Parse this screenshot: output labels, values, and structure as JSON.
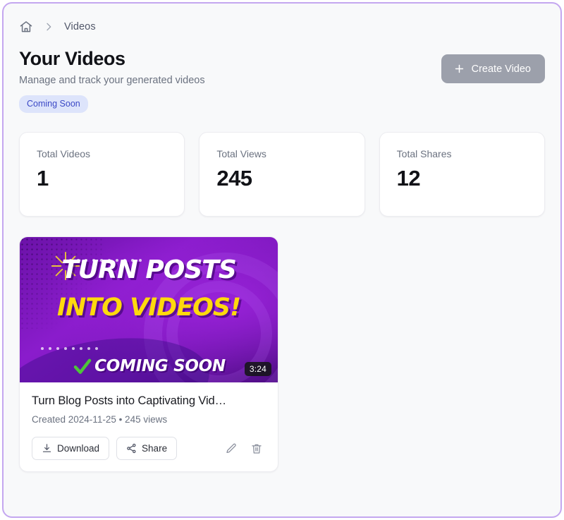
{
  "breadcrumb": {
    "home_icon": "home-icon",
    "separator_icon": "chevron-right-icon",
    "current": "Videos"
  },
  "header": {
    "title": "Your Videos",
    "subtitle": "Manage and track your generated videos",
    "status_badge": "Coming Soon",
    "create_button": {
      "label": "Create Video",
      "icon": "plus-icon",
      "disabled": true,
      "color": "#9ca0ab"
    }
  },
  "stats": [
    {
      "label": "Total Videos",
      "value": "1"
    },
    {
      "label": "Total Views",
      "value": "245"
    },
    {
      "label": "Total Shares",
      "value": "12"
    }
  ],
  "videos": [
    {
      "thumbnail": {
        "line1": "TURN POSTS",
        "line2": "INTO VIDEOS!",
        "overlay_text": "COMING SOON",
        "check_icon": "check-mark-icon",
        "colors": {
          "background_purple": "#8a1ccc",
          "headline_white": "#ffffff",
          "headline_yellow": "#ffd90d",
          "check_green": "#4ec43a"
        }
      },
      "duration": "3:24",
      "title": "Turn Blog Posts into Captivating Vid…",
      "meta": "Created 2024-11-25  •  245 views",
      "actions": {
        "download": {
          "label": "Download",
          "icon": "download-icon"
        },
        "share": {
          "label": "Share",
          "icon": "share-nodes-icon"
        },
        "edit_icon": "pencil-icon",
        "delete_icon": "trash-icon"
      }
    }
  ],
  "theme": {
    "frame_border": "#c4a7f0",
    "page_background": "#f8f9fa",
    "badge_background": "#dde4fb",
    "badge_text": "#3b49c6"
  }
}
